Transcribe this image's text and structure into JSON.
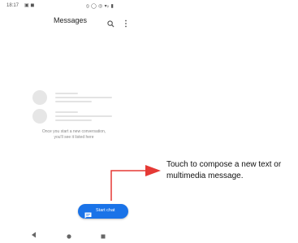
{
  "status_bar": {
    "time": "18:17",
    "notification_icons": "▣ ◼",
    "system_icons": "⦸ ◯ ◎ ▾ᵢₗ ▮"
  },
  "app_bar": {
    "title": "Messages",
    "search_icon": "search-icon",
    "more_icon": "more-vert-icon"
  },
  "empty_state": {
    "line1": "Once you start a new conversation,",
    "line2": "you'll see it listed here"
  },
  "fab": {
    "label": "Start chat",
    "icon": "chat-icon",
    "color": "#1a73e8"
  },
  "nav_bar": {
    "icons": [
      "back-icon",
      "home-icon",
      "recents-icon"
    ]
  },
  "annotation": {
    "text": "Touch to compose a new text or multimedia message.",
    "arrow_color": "#e53935"
  }
}
